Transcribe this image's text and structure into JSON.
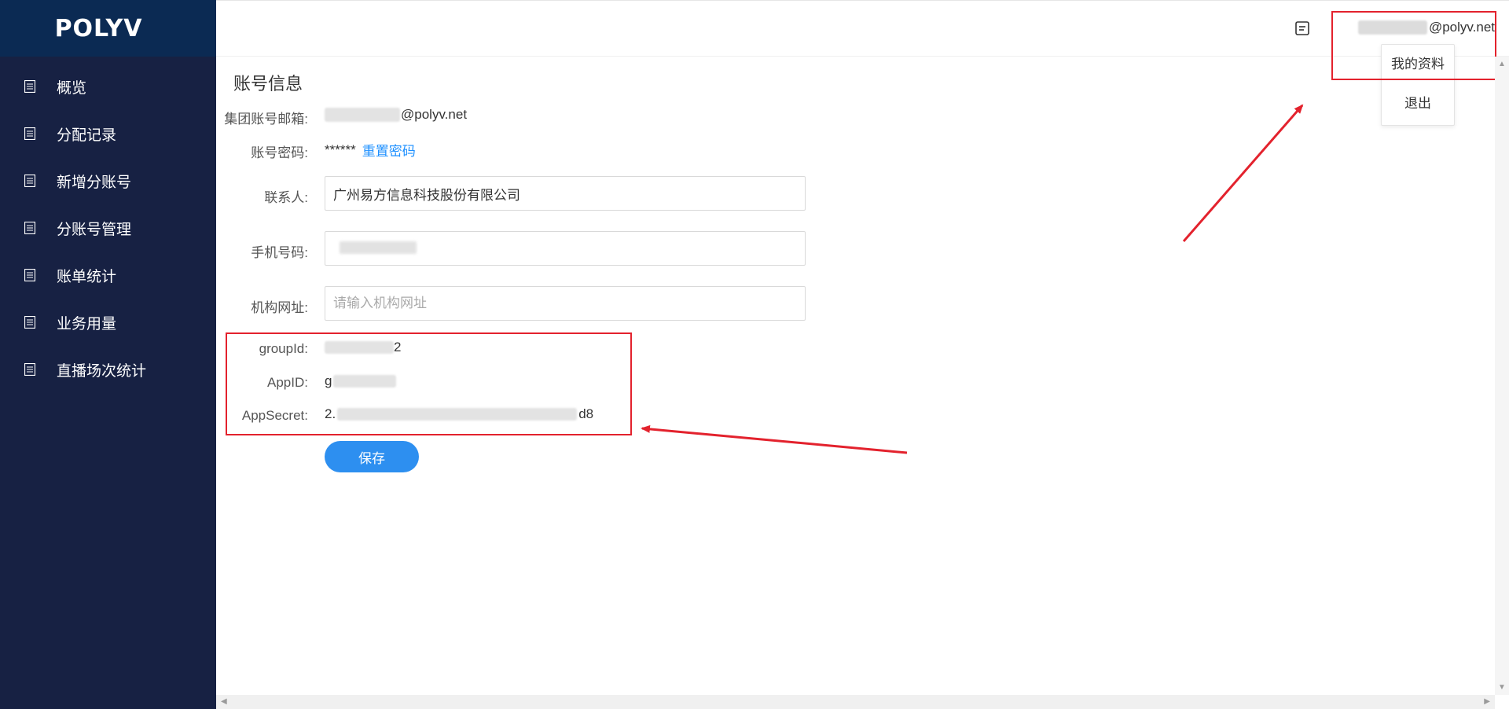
{
  "sidebar": {
    "logo": "POLYV",
    "items": [
      {
        "label": "概览",
        "icon": "document-icon"
      },
      {
        "label": "分配记录",
        "icon": "document-icon"
      },
      {
        "label": "新增分账号",
        "icon": "document-icon"
      },
      {
        "label": "分账号管理",
        "icon": "document-icon"
      },
      {
        "label": "账单统计",
        "icon": "document-icon"
      },
      {
        "label": "业务用量",
        "icon": "document-icon"
      },
      {
        "label": "直播场次统计",
        "icon": "document-icon"
      }
    ]
  },
  "header": {
    "message_icon": "message-icon",
    "user_email_suffix": "@polyv.net",
    "dropdown": [
      "我的资料",
      "退出"
    ]
  },
  "main": {
    "title": "账号信息",
    "fields": {
      "group_email_label": "集团账号邮箱:",
      "group_email_suffix": "@polyv.net",
      "password_label": "账号密码:",
      "password_mask": "******",
      "reset_link": "重置密码",
      "contact_label": "联系人:",
      "contact_value": "广州易方信息科技股份有限公司",
      "phone_label": "手机号码:",
      "site_label": "机构网址:",
      "site_placeholder": "请输入机构网址",
      "group_id_label": "groupId:",
      "group_id_prefix": "",
      "group_id_suffix": "2",
      "app_id_label": "AppID:",
      "app_id_prefix": "g",
      "app_secret_label": "AppSecret:",
      "app_secret_prefix": "2.",
      "app_secret_suffix": "d8"
    },
    "save_label": "保存"
  },
  "colors": {
    "sidebar_bg": "#172143",
    "logo_bg": "#0b2a53",
    "primary": "#2d8ff0",
    "highlight": "#e3222d"
  }
}
